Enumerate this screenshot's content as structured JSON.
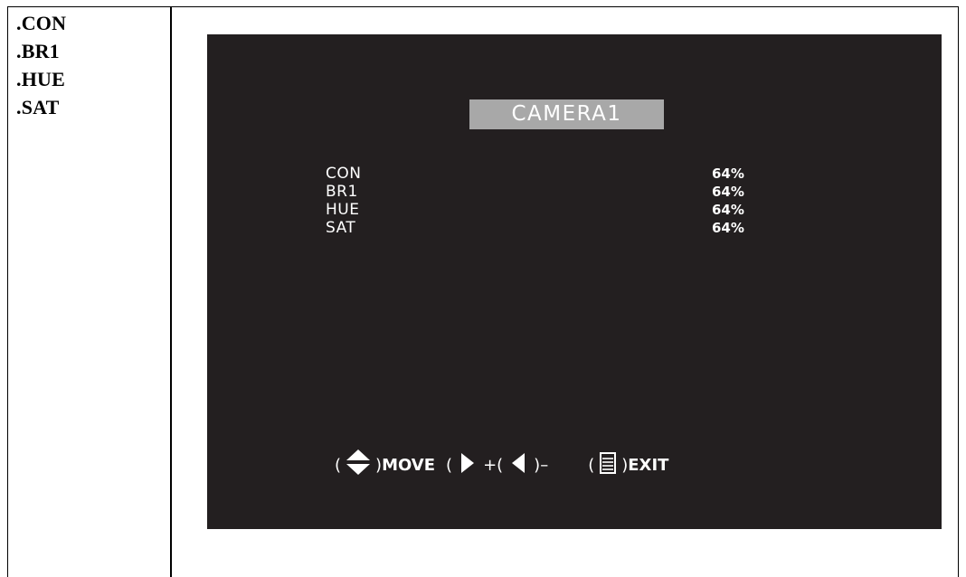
{
  "left_column": {
    "items": [
      ".CON",
      ".BR1",
      ".HUE",
      ".SAT"
    ]
  },
  "osd": {
    "title": "CAMERA1",
    "settings": [
      {
        "label": "CON",
        "value": "64%"
      },
      {
        "label": "BR1",
        "value": "64%"
      },
      {
        "label": "HUE",
        "value": "64%"
      },
      {
        "label": "SAT",
        "value": "64%"
      }
    ],
    "hints": {
      "open_paren": "(",
      "close_paren": ")",
      "move_label": "MOVE",
      "plus_label": "+(",
      "minus_label": ")–",
      "exit_label": "EXIT"
    },
    "icons": {
      "move": "up-down-arrow-icon",
      "plus": "right-arrow-icon",
      "minus": "left-arrow-icon",
      "exit": "menu-icon"
    },
    "colors": {
      "screen_bg": "#231f20",
      "title_bg": "#a8a8a8",
      "text": "#ffffff"
    }
  }
}
